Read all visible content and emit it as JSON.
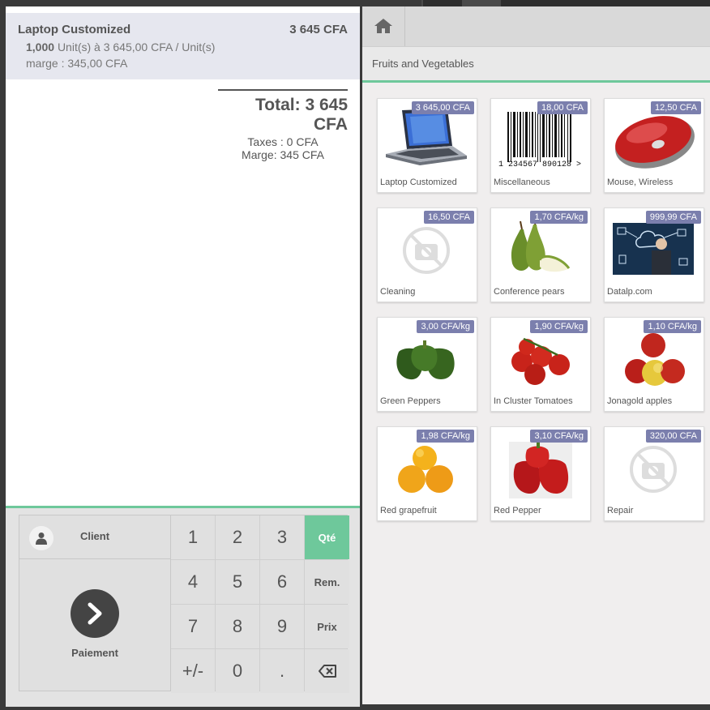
{
  "order": {
    "line": {
      "name": "Laptop Customized",
      "price": "3 645 CFA",
      "qty": "1,000",
      "unit_detail": "Unit(s) à 3 645,00 CFA / Unit(s)",
      "marge": "marge : 345,00 CFA"
    },
    "total": "Total: 3 645 CFA",
    "taxes": "Taxes : 0 CFA",
    "marge": "Marge: 345 CFA"
  },
  "actionpad": {
    "client_label": "Client",
    "payment_label": "Paiement"
  },
  "numpad": {
    "keys": [
      "1",
      "2",
      "3",
      "Qté",
      "4",
      "5",
      "6",
      "Rem.",
      "7",
      "8",
      "9",
      "Prix",
      "+/-",
      "0",
      "."
    ],
    "active_mode": "Qté"
  },
  "category": {
    "label": "Fruits and Vegetables"
  },
  "products": [
    {
      "name": "Laptop Customized",
      "price": "3 645,00 CFA",
      "icon": "laptop-image"
    },
    {
      "name": "Miscellaneous",
      "price": "18,00 CFA",
      "icon": "barcode-image",
      "barcode_text": "1  234567  890128  >"
    },
    {
      "name": "Mouse, Wireless",
      "price": "12,50 CFA",
      "icon": "mouse-image"
    },
    {
      "name": "Cleaning",
      "price": "16,50 CFA",
      "icon": "no-photo-icon"
    },
    {
      "name": "Conference pears",
      "price": "1,70 CFA/kg",
      "icon": "pears-image"
    },
    {
      "name": "Datalp.com",
      "price": "999,99 CFA",
      "icon": "cloud-business-image"
    },
    {
      "name": "Green Peppers",
      "price": "3,00 CFA/kg",
      "icon": "green-peppers-image"
    },
    {
      "name": "In Cluster Tomatoes",
      "price": "1,90 CFA/kg",
      "icon": "tomatoes-image"
    },
    {
      "name": "Jonagold apples",
      "price": "1,10 CFA/kg",
      "icon": "apples-image"
    },
    {
      "name": "Red grapefruit",
      "price": "1,98 CFA/kg",
      "icon": "grapefruit-image"
    },
    {
      "name": "Red Pepper",
      "price": "3,10 CFA/kg",
      "icon": "red-pepper-image"
    },
    {
      "name": "Repair",
      "price": "320,00 CFA",
      "icon": "no-photo-icon"
    }
  ],
  "colors": {
    "accent": "#6ec89b",
    "price_tag": "#7b7fad"
  }
}
